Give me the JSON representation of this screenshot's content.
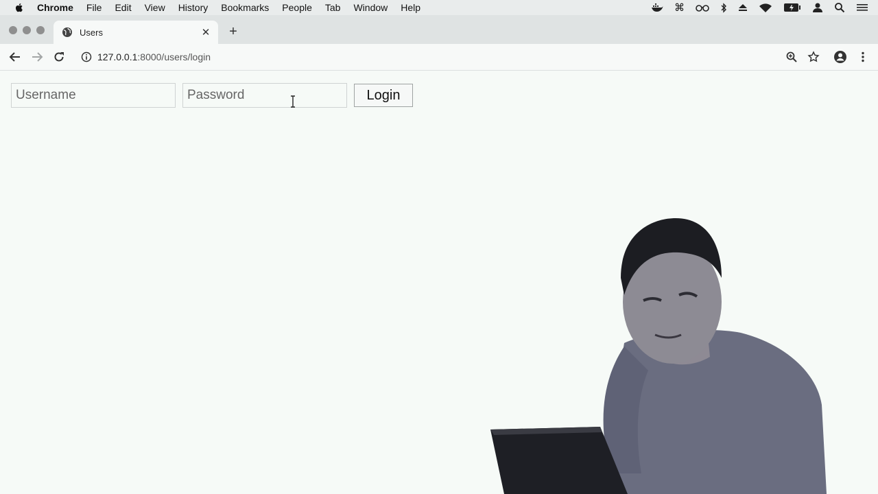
{
  "menubar": {
    "app_name": "Chrome",
    "items": [
      "File",
      "Edit",
      "View",
      "History",
      "Bookmarks",
      "People",
      "Tab",
      "Window",
      "Help"
    ],
    "status_icons": [
      "docker-icon",
      "command-icon",
      "glasses-icon",
      "bluetooth-icon",
      "eject-icon",
      "wifi-icon",
      "battery-icon",
      "user-icon",
      "spotlight-icon",
      "list-icon"
    ]
  },
  "tab": {
    "title": "Users",
    "close_glyph": "✕",
    "new_tab_glyph": "+"
  },
  "toolbar": {
    "url_host": "127.0.0.1",
    "url_path": ":8000/users/login"
  },
  "login": {
    "username_placeholder": "Username",
    "password_placeholder": "Password",
    "button_label": "Login"
  }
}
